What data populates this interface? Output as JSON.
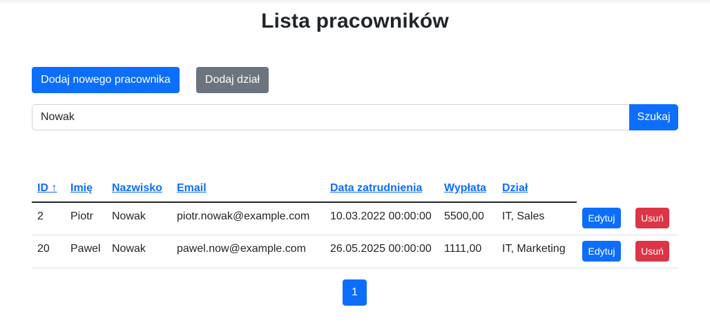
{
  "page_title": "Lista pracowników",
  "actions": {
    "add_employee": "Dodaj nowego pracownika",
    "add_department": "Dodaj dział"
  },
  "search": {
    "value": "Nowak",
    "button": "Szukaj"
  },
  "table": {
    "headers": {
      "id": "ID ↑",
      "first_name": "Imię",
      "last_name": "Nazwisko",
      "email": "Email",
      "hire_date": "Data zatrudnienia",
      "salary": "Wypłata",
      "department": "Dział"
    },
    "rows": [
      {
        "id": "2",
        "first_name": "Piotr",
        "last_name": "Nowak",
        "email": "piotr.nowak@example.com",
        "hire_date": "10.03.2022 00:00:00",
        "salary": "5500,00",
        "department": "IT, Sales",
        "edit": "Edytuj",
        "delete": "Usuń"
      },
      {
        "id": "20",
        "first_name": "Pawel",
        "last_name": "Nowak",
        "email": "pawel.now@example.com",
        "hire_date": "26.05.2025 00:00:00",
        "salary": "1111,00",
        "department": "IT, Marketing",
        "edit": "Edytuj",
        "delete": "Usuń"
      }
    ]
  },
  "pagination": {
    "current_page": "1"
  },
  "colors": {
    "primary": "#0d6efd",
    "secondary": "#6c757d",
    "danger": "#dc3545"
  }
}
